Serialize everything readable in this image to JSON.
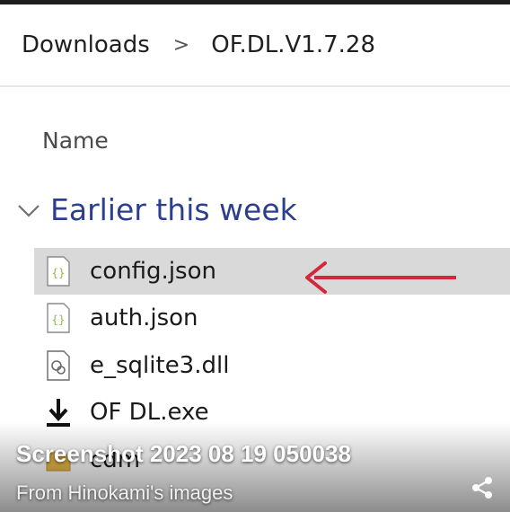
{
  "breadcrumb": {
    "items": [
      "Downloads",
      "OF.DL.V1.7.28"
    ],
    "separator": ">"
  },
  "list": {
    "column_header": "Name",
    "group_label": "Earlier this week",
    "files": [
      {
        "name": "config.json",
        "icon": "json-file-icon",
        "selected": true
      },
      {
        "name": "auth.json",
        "icon": "json-file-icon",
        "selected": false
      },
      {
        "name": "e_sqlite3.dll",
        "icon": "dll-file-icon",
        "selected": false
      },
      {
        "name": "OF DL.exe",
        "icon": "download-arrow-icon",
        "selected": false
      },
      {
        "name": "cdm",
        "icon": "folder-icon",
        "selected": false
      }
    ]
  },
  "overlay": {
    "caption": "Screenshot 2023 08 19 050038",
    "source": "From Hinokami's images"
  },
  "colors": {
    "group_label": "#2c3e8f",
    "selection": "#d9d9d9",
    "annotation_arrow": "#d3273e",
    "folder": "#e8b84a"
  }
}
